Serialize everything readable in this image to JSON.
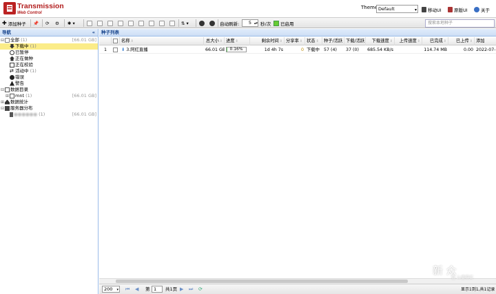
{
  "header": {
    "brand_line1": "Transmission",
    "brand_line2": "Web Control",
    "theme_label": "Theme:",
    "theme_value": "Default",
    "mobile_ui": "移动UI",
    "original_ui": "原版UI",
    "about": "关于"
  },
  "toolbar": {
    "add_torrent": "添加种子",
    "auto_refresh_label": "自动刷新:",
    "refresh_value": "5",
    "refresh_unit": "秒/次",
    "enabled": "已启用",
    "search_placeholder": "搜索本地种子"
  },
  "nav": {
    "title": "导航",
    "collapse": "«",
    "items": [
      {
        "label": "全部",
        "count": "(1)",
        "size": "[66.01 GB]"
      },
      {
        "label": "下载中",
        "count": "(1)"
      },
      {
        "label": "已暂停",
        "count": ""
      },
      {
        "label": "正在做种",
        "count": ""
      },
      {
        "label": "正在校验",
        "count": ""
      },
      {
        "label": "活动中",
        "count": "(1)"
      },
      {
        "label": "错误",
        "count": ""
      },
      {
        "label": "警告",
        "count": ""
      },
      {
        "label": "数据目录",
        "count": ""
      },
      {
        "label": "mnt",
        "count": "(1)",
        "size": "[66.01 GB]"
      },
      {
        "label": "数据统计",
        "count": ""
      },
      {
        "label": "服务器分布",
        "count": ""
      },
      {
        "label": "●●●●●●",
        "count": "(1)",
        "size": "[66.01 GB]"
      }
    ]
  },
  "torrents": {
    "title": "种子列表",
    "columns": [
      "名称",
      "总大小",
      "进度",
      "剩余时间",
      "分享率",
      "状态",
      "种子/活跃",
      "下载/活跃",
      "下载速度",
      "上传速度",
      "已完成",
      "已上传",
      "添加"
    ],
    "rows": [
      {
        "index": "1",
        "name": "3.阿红直播",
        "size": "66.01 GB",
        "progress": "0.16%",
        "progress_value": 0.0016,
        "remaining": "1d 4h 7s",
        "ratio": "0",
        "status": "下载中",
        "seeds": "57 (4)",
        "peers": "37 (0)",
        "down_speed": "685.54 KB/s",
        "up_speed": "",
        "completed": "114.74 MB",
        "uploaded": "0.00",
        "added": "2022-07-"
      }
    ]
  },
  "pager": {
    "page_size": "200",
    "page_prefix": "第",
    "page_value": "1",
    "page_suffix": "共1页",
    "summary": "显示1到1,共1记录"
  },
  "watermark": {
    "text": "新 众",
    "sub": "值 么值得买"
  }
}
